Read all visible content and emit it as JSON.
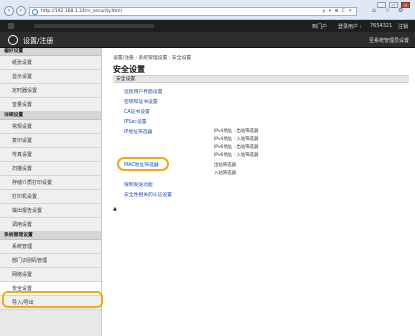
{
  "browser": {
    "url": "http://192.168.1.24/rs_security.html",
    "tools": "ρ ▾ ⊞ C ✕"
  },
  "top": {
    "links": [
      "到门户",
      "登录用户 :",
      "7654321",
      "注销"
    ]
  },
  "header": {
    "title": "设置/注册",
    "right_link": "至系统管理员设置"
  },
  "sidebar": {
    "sections": [
      {
        "label": "偏好设置",
        "items": [
          "纸张设置",
          "显示设置",
          "定时器设置",
          "音量设置"
        ]
      },
      {
        "label": "详细设置",
        "items": [
          "常规设置",
          "复印设置",
          "传真设置",
          "扫描设置",
          "存储介质打印设置",
          "打印机设置",
          "输出报告设置",
          "调用设置"
        ]
      },
      {
        "label": "系统管理设置",
        "items": [
          "系统管理",
          "部门识别码管理",
          "网络设置",
          "安全设置",
          "导入/导出"
        ]
      }
    ]
  },
  "main": {
    "breadcrumb": "设置/注册 : 系统管理设置 : 安全设置",
    "title": "安全设置",
    "section_header": "安全设置",
    "links": [
      "远程用户界面设置",
      "密钥和证书设置",
      "CA证书设置",
      "IPSec设置",
      "IP地址筛选器",
      "MAC地址筛选器",
      "限制发送功能",
      "安全性相关的认证设置"
    ],
    "ip_filter_options": [
      "IPv4地址 : 出站筛选器",
      "IPv4地址 : 入站筛选器",
      "IPv6地址 : 出站筛选器",
      "IPv6地址 : 入站筛选器"
    ],
    "mac_filter_options": [
      "出站筛选器",
      "入站筛选器"
    ],
    "top_marker": "▲"
  }
}
